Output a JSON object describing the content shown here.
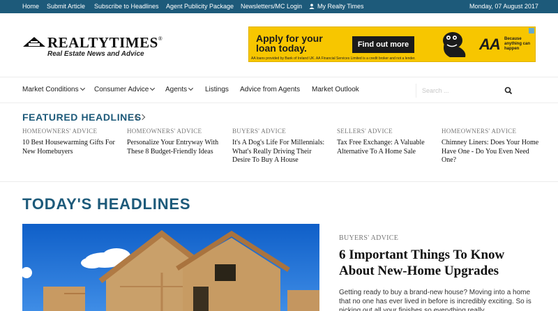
{
  "topbar": {
    "links": [
      "Home",
      "Submit Article",
      "Subscribe to Headlines",
      "Agent Publicity Package",
      "Newsletters/MC Login"
    ],
    "account_label": "My Realty Times",
    "account_icon": "user-icon",
    "date": "Monday, 07 August 2017"
  },
  "logo": {
    "brand": "REALTYTIMES",
    "registered": "®",
    "tagline": "Real Estate News and Advice"
  },
  "ad": {
    "headline": "Apply for your loan today.",
    "cta": "Find out more",
    "brand": "AA",
    "slogan": "Because anything can happen",
    "fine_print": "AA loans provided by Bank of Ireland UK. AA Financial Services Limited is a credit broker and not a lender."
  },
  "nav": {
    "items": [
      {
        "label": "Market Conditions",
        "dropdown": true
      },
      {
        "label": "Consumer Advice",
        "dropdown": true
      },
      {
        "label": "Agents",
        "dropdown": true
      },
      {
        "label": "Listings",
        "dropdown": false
      },
      {
        "label": "Advice from Agents",
        "dropdown": false
      },
      {
        "label": "Market Outlook",
        "dropdown": false
      }
    ],
    "search_placeholder": "Search ...",
    "search_icon": "search-icon"
  },
  "featured": {
    "title": "FEATURED HEADLINES",
    "items": [
      {
        "category": "HOMEOWNERS' ADVICE",
        "title": "10 Best Housewarming Gifts For New Homebuyers"
      },
      {
        "category": "HOMEOWNERS' ADVICE",
        "title": "Personalize Your Entryway With These 8 Budget-Friendly Ideas"
      },
      {
        "category": "BUYERS' ADVICE",
        "title": "It's A Dog's Life For Millennials: What's Really Driving Their Desire To Buy A House"
      },
      {
        "category": "SELLERS' ADVICE",
        "title": "Tax Free Exchange: A Valuable Alternative To A Home Sale"
      },
      {
        "category": "HOMEOWNERS' ADVICE",
        "title": "Chimney Liners: Does Your Home Have One - Do You Even Need One?"
      }
    ]
  },
  "today": {
    "title": "TODAY'S HEADLINES",
    "lead": {
      "category": "BUYERS' ADVICE",
      "title": "6 Important Things To Know About New-Home Upgrades",
      "excerpt": "Getting ready to buy a brand-new house? Moving into a home that no one has ever lived in before is incredibly exciting. So is picking out all your finishes so everything really"
    }
  },
  "colors": {
    "brand_blue": "#1d5a7a",
    "ad_yellow": "#f7c600",
    "sky_blue": "#1f6fd0"
  }
}
